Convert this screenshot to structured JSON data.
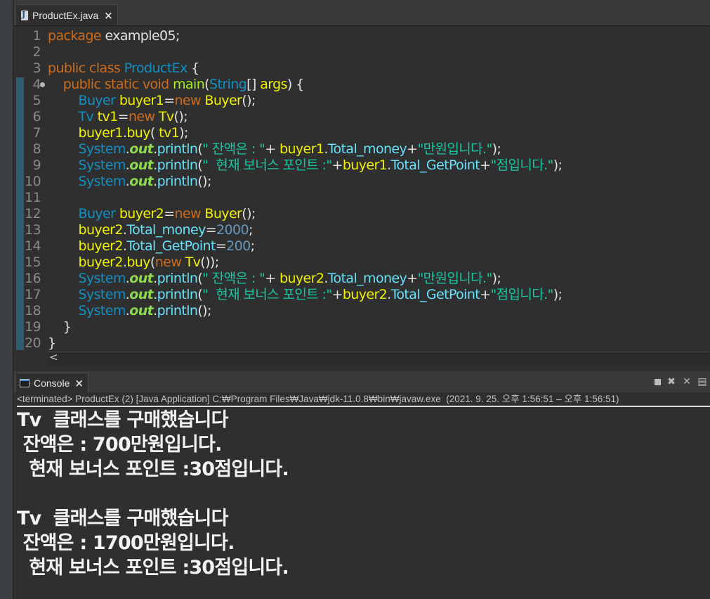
{
  "editor": {
    "tab_label": "ProductEx.java",
    "close_glyph": "×",
    "scroll_left_glyph": "<",
    "lines": [
      [
        [
          "kw",
          "package"
        ],
        [
          "pl",
          " example05;"
        ]
      ],
      [],
      [
        [
          "kw",
          "public"
        ],
        [
          "pl",
          " "
        ],
        [
          "kw",
          "class"
        ],
        [
          "pl",
          " "
        ],
        [
          "cls",
          "ProductEx"
        ],
        [
          "pl",
          " {"
        ]
      ],
      [
        [
          "pl",
          "    "
        ],
        [
          "kw",
          "public"
        ],
        [
          "pl",
          " "
        ],
        [
          "kw",
          "static"
        ],
        [
          "pl",
          " "
        ],
        [
          "kw",
          "void"
        ],
        [
          "pl",
          " "
        ],
        [
          "fn",
          "main"
        ],
        [
          "pl",
          "("
        ],
        [
          "ty",
          "String"
        ],
        [
          "pl",
          "[] "
        ],
        [
          "vr",
          "args"
        ],
        [
          "pl",
          ") {"
        ]
      ],
      [
        [
          "pl",
          "        "
        ],
        [
          "ty",
          "Buyer"
        ],
        [
          "pl",
          " "
        ],
        [
          "vr",
          "buyer1"
        ],
        [
          "pl",
          "="
        ],
        [
          "kw",
          "new"
        ],
        [
          "pl",
          " "
        ],
        [
          "vr",
          "Buyer"
        ],
        [
          "pl",
          "();"
        ]
      ],
      [
        [
          "pl",
          "        "
        ],
        [
          "ty",
          "Tv"
        ],
        [
          "pl",
          " "
        ],
        [
          "vr",
          "tv1"
        ],
        [
          "pl",
          "="
        ],
        [
          "kw",
          "new"
        ],
        [
          "pl",
          " "
        ],
        [
          "vr",
          "Tv"
        ],
        [
          "pl",
          "();"
        ]
      ],
      [
        [
          "pl",
          "        "
        ],
        [
          "vr",
          "buyer1"
        ],
        [
          "pl",
          "."
        ],
        [
          "vr",
          "buy"
        ],
        [
          "pl",
          "( "
        ],
        [
          "vr",
          "tv1"
        ],
        [
          "pl",
          ");"
        ]
      ],
      [
        [
          "pl",
          "        "
        ],
        [
          "ty",
          "System"
        ],
        [
          "pl",
          "."
        ],
        [
          "sta",
          "out"
        ],
        [
          "pl",
          "."
        ],
        [
          "fld",
          "println"
        ],
        [
          "pl",
          "("
        ],
        [
          "st",
          "\" 잔액은 : \""
        ],
        [
          "pl",
          "+ "
        ],
        [
          "vr",
          "buyer1"
        ],
        [
          "pl",
          "."
        ],
        [
          "fld",
          "Total_money"
        ],
        [
          "pl",
          "+"
        ],
        [
          "st",
          "\"만원입니다.\""
        ],
        [
          "pl",
          ");"
        ]
      ],
      [
        [
          "pl",
          "        "
        ],
        [
          "ty",
          "System"
        ],
        [
          "pl",
          "."
        ],
        [
          "sta",
          "out"
        ],
        [
          "pl",
          "."
        ],
        [
          "fld",
          "println"
        ],
        [
          "pl",
          "("
        ],
        [
          "st",
          "\"  현재 보너스 포인트 :\""
        ],
        [
          "pl",
          "+"
        ],
        [
          "vr",
          "buyer1"
        ],
        [
          "pl",
          "."
        ],
        [
          "fld",
          "Total_GetPoint"
        ],
        [
          "pl",
          "+"
        ],
        [
          "st",
          "\"점입니다.\""
        ],
        [
          "pl",
          ");"
        ]
      ],
      [
        [
          "pl",
          "        "
        ],
        [
          "ty",
          "System"
        ],
        [
          "pl",
          "."
        ],
        [
          "sta",
          "out"
        ],
        [
          "pl",
          "."
        ],
        [
          "fld",
          "println"
        ],
        [
          "pl",
          "();"
        ]
      ],
      [],
      [
        [
          "pl",
          "        "
        ],
        [
          "ty",
          "Buyer"
        ],
        [
          "pl",
          " "
        ],
        [
          "vr",
          "buyer2"
        ],
        [
          "pl",
          "="
        ],
        [
          "kw",
          "new"
        ],
        [
          "pl",
          " "
        ],
        [
          "vr",
          "Buyer"
        ],
        [
          "pl",
          "();"
        ]
      ],
      [
        [
          "pl",
          "        "
        ],
        [
          "vr",
          "buyer2"
        ],
        [
          "pl",
          "."
        ],
        [
          "fld",
          "Total_money"
        ],
        [
          "pl",
          "="
        ],
        [
          "nm",
          "2000"
        ],
        [
          "pl",
          ";"
        ]
      ],
      [
        [
          "pl",
          "        "
        ],
        [
          "vr",
          "buyer2"
        ],
        [
          "pl",
          "."
        ],
        [
          "fld",
          "Total_GetPoint"
        ],
        [
          "pl",
          "="
        ],
        [
          "nm",
          "200"
        ],
        [
          "pl",
          ";"
        ]
      ],
      [
        [
          "pl",
          "        "
        ],
        [
          "vr",
          "buyer2"
        ],
        [
          "pl",
          "."
        ],
        [
          "vr",
          "buy"
        ],
        [
          "pl",
          "("
        ],
        [
          "kw",
          "new"
        ],
        [
          "pl",
          " "
        ],
        [
          "vr",
          "Tv"
        ],
        [
          "pl",
          "());"
        ]
      ],
      [
        [
          "pl",
          "        "
        ],
        [
          "ty",
          "System"
        ],
        [
          "pl",
          "."
        ],
        [
          "sta",
          "out"
        ],
        [
          "pl",
          "."
        ],
        [
          "fld",
          "println"
        ],
        [
          "pl",
          "("
        ],
        [
          "st",
          "\" 잔액은 : \""
        ],
        [
          "pl",
          "+ "
        ],
        [
          "vr",
          "buyer2"
        ],
        [
          "pl",
          "."
        ],
        [
          "fld",
          "Total_money"
        ],
        [
          "pl",
          "+"
        ],
        [
          "st",
          "\"만원입니다.\""
        ],
        [
          "pl",
          ");"
        ]
      ],
      [
        [
          "pl",
          "        "
        ],
        [
          "ty",
          "System"
        ],
        [
          "pl",
          "."
        ],
        [
          "sta",
          "out"
        ],
        [
          "pl",
          "."
        ],
        [
          "fld",
          "println"
        ],
        [
          "pl",
          "("
        ],
        [
          "st",
          "\"  현재 보너스 포인트 :\""
        ],
        [
          "pl",
          "+"
        ],
        [
          "vr",
          "buyer2"
        ],
        [
          "pl",
          "."
        ],
        [
          "fld",
          "Total_GetPoint"
        ],
        [
          "pl",
          "+"
        ],
        [
          "st",
          "\"점입니다.\""
        ],
        [
          "pl",
          ");"
        ]
      ],
      [
        [
          "pl",
          "        "
        ],
        [
          "ty",
          "System"
        ],
        [
          "pl",
          "."
        ],
        [
          "sta",
          "out"
        ],
        [
          "pl",
          "."
        ],
        [
          "fld",
          "println"
        ],
        [
          "pl",
          "();"
        ]
      ],
      [
        [
          "pl",
          "    }"
        ]
      ],
      [
        [
          "pl",
          "}"
        ]
      ]
    ],
    "line_numbers": [
      "1",
      "2",
      "3",
      "4",
      "5",
      "6",
      "7",
      "8",
      "9",
      "10",
      "11",
      "12",
      "13",
      "14",
      "15",
      "16",
      "17",
      "18",
      "19",
      "20"
    ]
  },
  "console": {
    "tab_label": "Console",
    "close_glyph": "×",
    "status": "<terminated> ProductEx (2) [Java Application] C:₩Program Files₩Java₩jdk-11.0.8₩bin₩javaw.exe  (2021. 9. 25. 오후 1:56:51 – 오후 1:56:51)",
    "toolbar_icons": [
      "stop-icon",
      "remove-launch-icon",
      "remove-all-icon",
      "pin-console-icon"
    ],
    "output": [
      "Tv  클래스를 구매했습니다",
      " 잔액은 : 700만원입니다.",
      "  현재 보너스 포인트 :30점입니다.",
      "",
      "Tv  클래스를 구매했습니다",
      " 잔액은 : 1700만원입니다.",
      "  현재 보너스 포인트 :30점입니다."
    ]
  },
  "colors": {
    "background": "#2f2f2f",
    "keyword": "#cc6c1d",
    "type": "#1290c3",
    "variable": "#f2f200",
    "field": "#66e1f8",
    "method": "#a7ec21",
    "string": "#17c6a3",
    "number": "#6897bb",
    "static_field": "#8dda4e"
  }
}
